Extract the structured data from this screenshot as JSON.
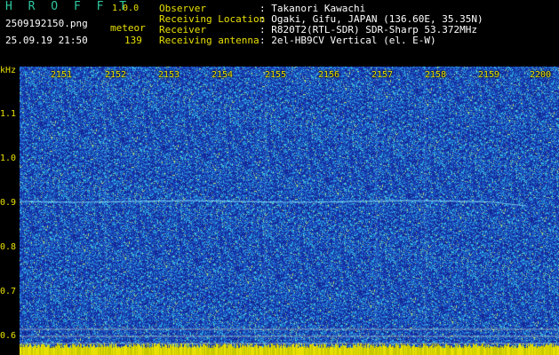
{
  "header": {
    "app_title": "H R O F F T",
    "version": "1.0.0",
    "filename": "2509192150.png",
    "detection_type": "meteor",
    "datetime": "25.09.19 21:50",
    "count": "139",
    "info": [
      {
        "label": "Observer",
        "value": ": Takanori Kawachi"
      },
      {
        "label": "Receiving Location",
        "value": ": Ogaki, Gifu, JAPAN (136.60E, 35.35N)"
      },
      {
        "label": "Receiver",
        "value": ": R820T2(RTL-SDR) SDR-Sharp 53.372MHz"
      },
      {
        "label": "Receiving antenna",
        "value": ": 2el-HB9CV Vertical (el. E-W)"
      }
    ]
  },
  "spectrogram": {
    "y_unit": "kHz",
    "y_ticks": [
      "1.1",
      "1.0",
      "0.9",
      "0.8",
      "0.7",
      "0.6"
    ],
    "x_ticks": [
      "2151",
      "2152",
      "2153",
      "2154",
      "2155",
      "2156",
      "2157",
      "2158",
      "2159",
      "2200"
    ],
    "colors": {
      "label": "#e8e000",
      "background": "#1a2ea0",
      "trace": "#8ff0ff"
    }
  }
}
